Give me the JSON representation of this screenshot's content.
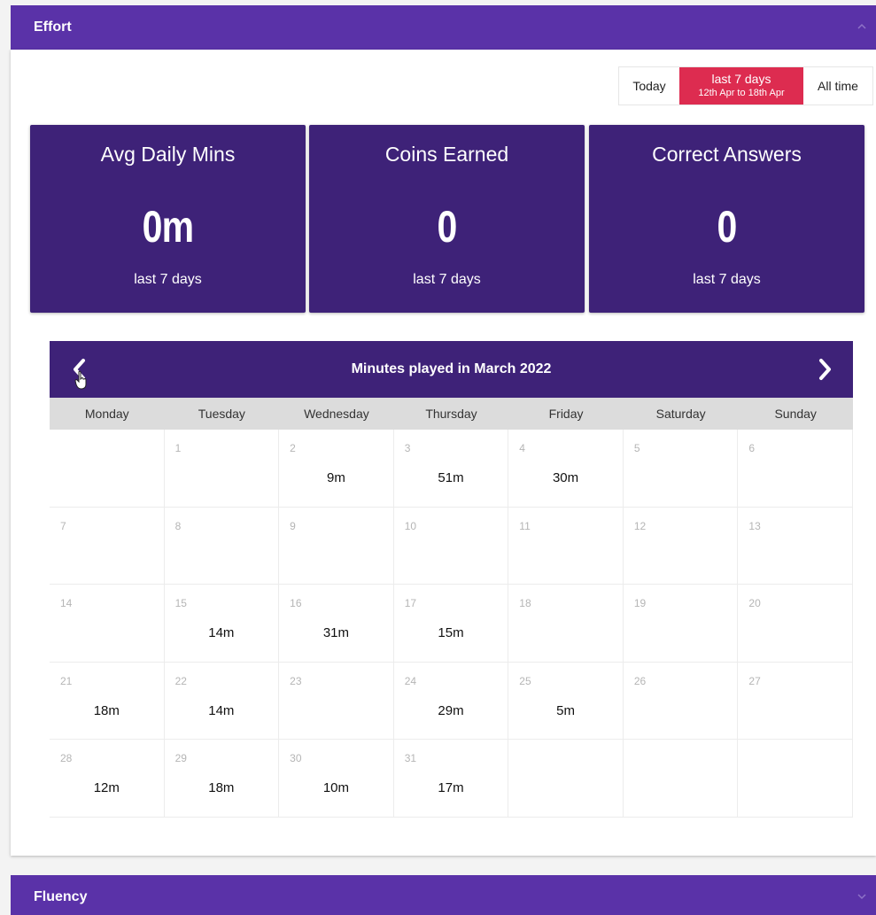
{
  "effort_panel": {
    "title": "Effort"
  },
  "fluency_panel": {
    "title": "Fluency"
  },
  "range_toggle": {
    "today": "Today",
    "active_label": "last 7 days",
    "active_range": "12th Apr to 18th Apr",
    "all_time": "All time"
  },
  "stats": [
    {
      "title": "Avg Daily Mins",
      "value": "0m",
      "sub": "last 7 days"
    },
    {
      "title": "Coins Earned",
      "value": "0",
      "sub": "last 7 days"
    },
    {
      "title": "Correct Answers",
      "value": "0",
      "sub": "last 7 days"
    }
  ],
  "calendar": {
    "title": "Minutes played in March 2022",
    "days": [
      "Monday",
      "Tuesday",
      "Wednesday",
      "Thursday",
      "Friday",
      "Saturday",
      "Sunday"
    ],
    "cells": [
      {
        "d": "",
        "m": ""
      },
      {
        "d": "1",
        "m": ""
      },
      {
        "d": "2",
        "m": "9m"
      },
      {
        "d": "3",
        "m": "51m"
      },
      {
        "d": "4",
        "m": "30m"
      },
      {
        "d": "5",
        "m": ""
      },
      {
        "d": "6",
        "m": ""
      },
      {
        "d": "7",
        "m": ""
      },
      {
        "d": "8",
        "m": ""
      },
      {
        "d": "9",
        "m": ""
      },
      {
        "d": "10",
        "m": ""
      },
      {
        "d": "11",
        "m": ""
      },
      {
        "d": "12",
        "m": ""
      },
      {
        "d": "13",
        "m": ""
      },
      {
        "d": "14",
        "m": ""
      },
      {
        "d": "15",
        "m": "14m"
      },
      {
        "d": "16",
        "m": "31m"
      },
      {
        "d": "17",
        "m": "15m"
      },
      {
        "d": "18",
        "m": ""
      },
      {
        "d": "19",
        "m": ""
      },
      {
        "d": "20",
        "m": ""
      },
      {
        "d": "21",
        "m": "18m"
      },
      {
        "d": "22",
        "m": "14m"
      },
      {
        "d": "23",
        "m": ""
      },
      {
        "d": "24",
        "m": "29m"
      },
      {
        "d": "25",
        "m": "5m"
      },
      {
        "d": "26",
        "m": ""
      },
      {
        "d": "27",
        "m": ""
      },
      {
        "d": "28",
        "m": "12m"
      },
      {
        "d": "29",
        "m": "18m"
      },
      {
        "d": "30",
        "m": "10m"
      },
      {
        "d": "31",
        "m": "17m"
      },
      {
        "d": "",
        "m": ""
      },
      {
        "d": "",
        "m": ""
      },
      {
        "d": "",
        "m": ""
      }
    ]
  },
  "icons": {
    "collapse": "chevron-up-icon",
    "expand": "chevron-down-icon",
    "prev": "chevron-left-icon",
    "next": "chevron-right-icon"
  },
  "colors": {
    "header": "#5a32a8",
    "card": "#3e2278",
    "active": "#dd2c50"
  }
}
